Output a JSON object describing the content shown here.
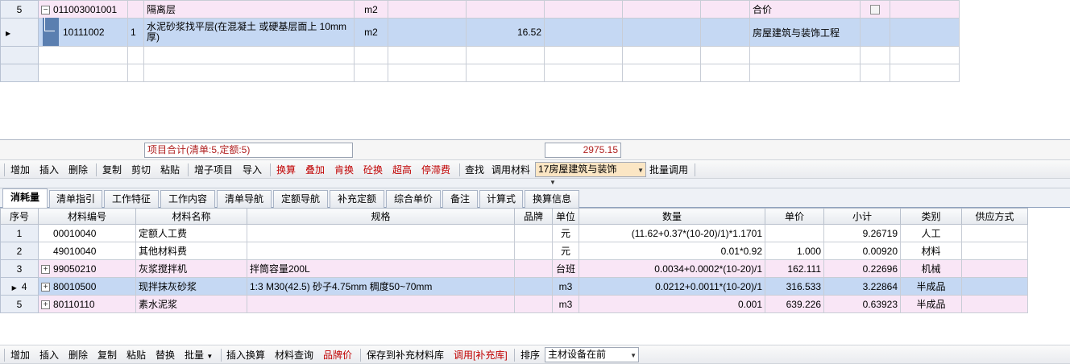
{
  "top_grid": {
    "rows": [
      {
        "no": "5",
        "code": "011003001001",
        "idx": "",
        "name": "隔离层",
        "unit": "m2",
        "qty": "",
        "category": "合价",
        "checkbox": true
      },
      {
        "no": "",
        "code": "10111002",
        "idx": "1",
        "name": "水泥砂浆找平层(在混凝土 或硬基层面上 10mm 厚)",
        "unit": "m2",
        "qty": "16.52",
        "category": "房屋建筑与装饰工程",
        "checkbox": false
      }
    ]
  },
  "summary": {
    "label": "项目合计(清单:5,定额:5)",
    "total": "2975.15"
  },
  "toolbar1": {
    "add": "增加",
    "insert": "插入",
    "delete": "删除",
    "copy": "复制",
    "cut": "剪切",
    "paste": "粘贴",
    "add_sub": "增子项目",
    "import": "导入",
    "calc": "换算",
    "overlay": "叠加",
    "meat": "肯换",
    "concrete": "砼换",
    "height": "超高",
    "stall": "停滞费",
    "find": "查找",
    "call_material": "调用材料",
    "combo_value": "17房屋建筑与装饰",
    "batch": "批量调用"
  },
  "tabs": [
    "消耗量",
    "清单指引",
    "工作特征",
    "工作内容",
    "清单导航",
    "定额导航",
    "补充定额",
    "综合单价",
    "备注",
    "计算式",
    "换算信息"
  ],
  "bottom_grid": {
    "headers": [
      "序号",
      "材料编号",
      "材料名称",
      "规格",
      "品牌",
      "单位",
      "数量",
      "单价",
      "小计",
      "类别",
      "供应方式"
    ],
    "rows": [
      {
        "no": "1",
        "expand": false,
        "code": "00010040",
        "name": "定额人工费",
        "spec": "",
        "brand": "",
        "unit": "元",
        "qty": "(11.62+0.37*(10-20)/1)*1.1701",
        "price": "",
        "subtotal": "9.26719",
        "type": "人工",
        "supply": ""
      },
      {
        "no": "2",
        "expand": false,
        "code": "49010040",
        "name": "其他材料费",
        "spec": "",
        "brand": "",
        "unit": "元",
        "qty": "0.01*0.92",
        "price": "1.000",
        "subtotal": "0.00920",
        "type": "材料",
        "supply": ""
      },
      {
        "no": "3",
        "expand": true,
        "code": "99050210",
        "name": "灰浆搅拌机",
        "spec": "拌筒容量200L",
        "brand": "",
        "unit": "台班",
        "qty": "0.0034+0.0002*(10-20)/1",
        "price": "162.111",
        "subtotal": "0.22696",
        "type": "机械",
        "supply": ""
      },
      {
        "no": "4",
        "expand": true,
        "code": "80010500",
        "name": "现拌抹灰砂浆",
        "spec": "1:3 M30(42.5) 砂子4.75mm 稠度50~70mm",
        "brand": "",
        "unit": "m3",
        "qty": "0.0212+0.0011*(10-20)/1",
        "price": "316.533",
        "subtotal": "3.22864",
        "type": "半成品",
        "supply": ""
      },
      {
        "no": "5",
        "expand": true,
        "code": "80110110",
        "name": "素水泥浆",
        "spec": "",
        "brand": "",
        "unit": "m3",
        "qty": "0.001",
        "price": "639.226",
        "subtotal": "0.63923",
        "type": "半成品",
        "supply": ""
      }
    ]
  },
  "toolbar2": {
    "add": "增加",
    "insert": "插入",
    "delete": "删除",
    "copy": "复制",
    "paste": "粘贴",
    "replace": "替换",
    "batch": "批量",
    "insert_calc": "插入换算",
    "material_query": "材料查询",
    "brand_price": "品牌价",
    "save_supp": "保存到补充材料库",
    "call_supp": "调用[补充库]",
    "sort": "排序",
    "combo_value": "主材设备在前"
  },
  "colors": {
    "pink_row": "#f9e6f6",
    "blue_row": "#c5d8f3",
    "red_text": "#c00000"
  }
}
